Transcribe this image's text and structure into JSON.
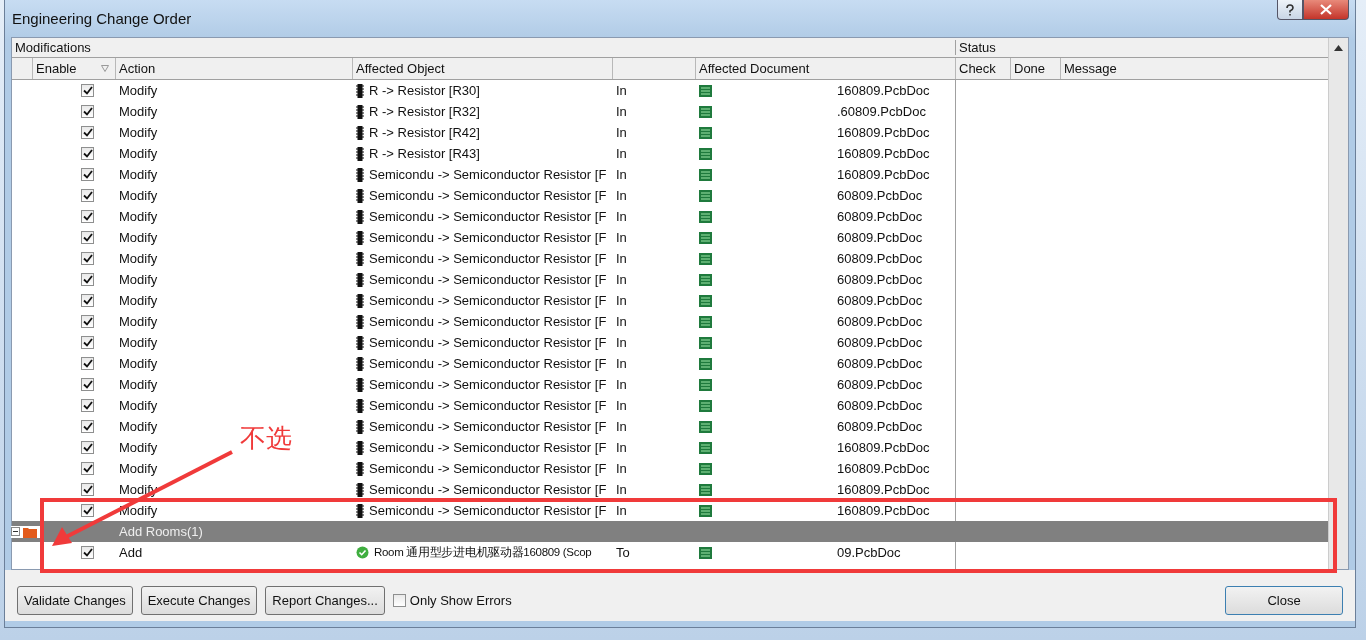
{
  "window": {
    "title": "Engineering Change Order"
  },
  "grid": {
    "section_left": "Modifications",
    "section_right": "Status",
    "columns": [
      "Enable",
      "Action",
      "Affected Object",
      "Affected Document",
      "Check",
      "Done",
      "Message"
    ],
    "rows": [
      {
        "kind": "component",
        "checked": true,
        "action": "Modify",
        "object": "R -> Resistor [R30]",
        "column_4": "In",
        "document": "160809.PcbDoc"
      },
      {
        "kind": "component",
        "checked": true,
        "action": "Modify",
        "object": "R -> Resistor [R32]",
        "column_4": "In",
        "document": ".60809.PcbDoc"
      },
      {
        "kind": "component",
        "checked": true,
        "action": "Modify",
        "object": "R -> Resistor [R42]",
        "column_4": "In",
        "document": "160809.PcbDoc"
      },
      {
        "kind": "component",
        "checked": true,
        "action": "Modify",
        "object": "R -> Resistor [R43]",
        "column_4": "In",
        "document": "160809.PcbDoc"
      },
      {
        "kind": "component",
        "checked": true,
        "action": "Modify",
        "object": "Semicondu -> Semiconductor Resistor [F",
        "column_4": "In",
        "document": "160809.PcbDoc"
      },
      {
        "kind": "component",
        "checked": true,
        "action": "Modify",
        "object": "Semicondu -> Semiconductor Resistor [F",
        "column_4": "In",
        "document": "60809.PcbDoc"
      },
      {
        "kind": "component",
        "checked": true,
        "action": "Modify",
        "object": "Semicondu -> Semiconductor Resistor [F",
        "column_4": "In",
        "document": "60809.PcbDoc"
      },
      {
        "kind": "component",
        "checked": true,
        "action": "Modify",
        "object": "Semicondu -> Semiconductor Resistor [F",
        "column_4": "In",
        "document": "60809.PcbDoc"
      },
      {
        "kind": "component",
        "checked": true,
        "action": "Modify",
        "object": "Semicondu -> Semiconductor Resistor [F",
        "column_4": "In",
        "document": "60809.PcbDoc"
      },
      {
        "kind": "component",
        "checked": true,
        "action": "Modify",
        "object": "Semicondu -> Semiconductor Resistor [F",
        "column_4": "In",
        "document": "60809.PcbDoc"
      },
      {
        "kind": "component",
        "checked": true,
        "action": "Modify",
        "object": "Semicondu -> Semiconductor Resistor [F",
        "column_4": "In",
        "document": "60809.PcbDoc"
      },
      {
        "kind": "component",
        "checked": true,
        "action": "Modify",
        "object": "Semicondu -> Semiconductor Resistor [F",
        "column_4": "In",
        "document": "60809.PcbDoc"
      },
      {
        "kind": "component",
        "checked": true,
        "action": "Modify",
        "object": "Semicondu -> Semiconductor Resistor [F",
        "column_4": "In",
        "document": "60809.PcbDoc"
      },
      {
        "kind": "component",
        "checked": true,
        "action": "Modify",
        "object": "Semicondu -> Semiconductor Resistor [F",
        "column_4": "In",
        "document": "60809.PcbDoc"
      },
      {
        "kind": "component",
        "checked": true,
        "action": "Modify",
        "object": "Semicondu -> Semiconductor Resistor [F",
        "column_4": "In",
        "document": "60809.PcbDoc"
      },
      {
        "kind": "component",
        "checked": true,
        "action": "Modify",
        "object": "Semicondu -> Semiconductor Resistor [F",
        "column_4": "In",
        "document": "60809.PcbDoc"
      },
      {
        "kind": "component",
        "checked": true,
        "action": "Modify",
        "object": "Semicondu -> Semiconductor Resistor [F",
        "column_4": "In",
        "document": "60809.PcbDoc"
      },
      {
        "kind": "component",
        "checked": true,
        "action": "Modify",
        "object": "Semicondu -> Semiconductor Resistor [F",
        "column_4": "In",
        "document": "160809.PcbDoc"
      },
      {
        "kind": "component",
        "checked": true,
        "action": "Modify",
        "object": "Semicondu -> Semiconductor Resistor [F",
        "column_4": "In",
        "document": "160809.PcbDoc"
      },
      {
        "kind": "component",
        "checked": true,
        "action": "Modify",
        "object": "Semicondu -> Semiconductor Resistor [F",
        "column_4": "In",
        "document": "160809.PcbDoc"
      },
      {
        "kind": "component",
        "checked": true,
        "action": "Modify",
        "object": "Semicondu -> Semiconductor Resistor [F",
        "column_4": "In",
        "document": "160809.PcbDoc"
      },
      {
        "kind": "group",
        "expanded": true,
        "label": "Add Rooms(1)"
      },
      {
        "kind": "room",
        "checked": true,
        "action": "Add",
        "object": "Room 通用型步进电机驱动器160809 (Scop",
        "column_4": "To",
        "document": "09.PcbDoc"
      }
    ]
  },
  "buttons": [
    {
      "label": "Validate Changes"
    },
    {
      "label": "Execute Changes"
    },
    {
      "label": "Report Changes..."
    }
  ],
  "only_show_errors": {
    "label": "Only Show Errors",
    "checked": false
  },
  "close_button": "Close",
  "annotation": {
    "label": "不选"
  }
}
